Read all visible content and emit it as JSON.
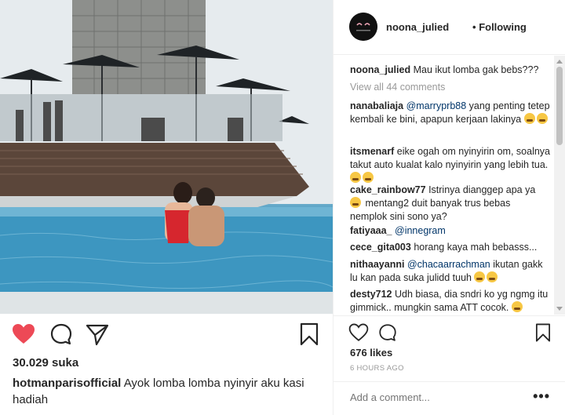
{
  "left": {
    "likes": "30.029 suka",
    "caption_user": "hotmanparisofficial",
    "caption_text": "Ayok lomba lomba nyinyir aku kasi hadiah"
  },
  "header": {
    "username": "noona_julied",
    "separator": "•",
    "follow_status": "Following"
  },
  "comments": {
    "caption": {
      "user": "noona_julied",
      "text": "Mau ikut lomba gak bebs???"
    },
    "view_all": "View all 44 comments",
    "items": [
      {
        "user": "nanabaliaja",
        "mention": "@marryprb88",
        "text": "yang penting tetep kembali ke bini, apapun kerjaan lakinya"
      },
      {
        "user": "itsmenarf",
        "text": "eike ogah om nyinyirin om, soalnya takut auto kualat kalo nyinyirin yang lebih tua."
      },
      {
        "user": "cake_rainbow77",
        "text": "Istrinya dianggep apa ya",
        "text2": "mentang2 duit banyak trus bebas nemplok sini sono ya?"
      },
      {
        "user": "fatiyaaa_",
        "mention": "@innegram"
      },
      {
        "user": "cece_gita003",
        "text": "horang kaya mah bebasss..."
      },
      {
        "user": "nithaayanni",
        "mention": "@chacaarrachman",
        "text": "ikutan gakk lu kan pada suka julidd tuuh"
      },
      {
        "user": "desty712",
        "text": "Udh biasa, dia sndri ko yg ngmg itu gimmick.. mungkin sama ATT cocok."
      }
    ]
  },
  "right": {
    "likes": "676 likes",
    "time": "6 HOURS AGO",
    "add_comment_placeholder": "Add a comment...",
    "more": "•••"
  },
  "colors": {
    "heart_red": "#ed4956",
    "mention_blue": "#003569",
    "muted_gray": "#999999",
    "border": "#efefef"
  },
  "icons": [
    "heart-icon",
    "comment-icon",
    "share-icon",
    "bookmark-icon",
    "more-icon"
  ]
}
